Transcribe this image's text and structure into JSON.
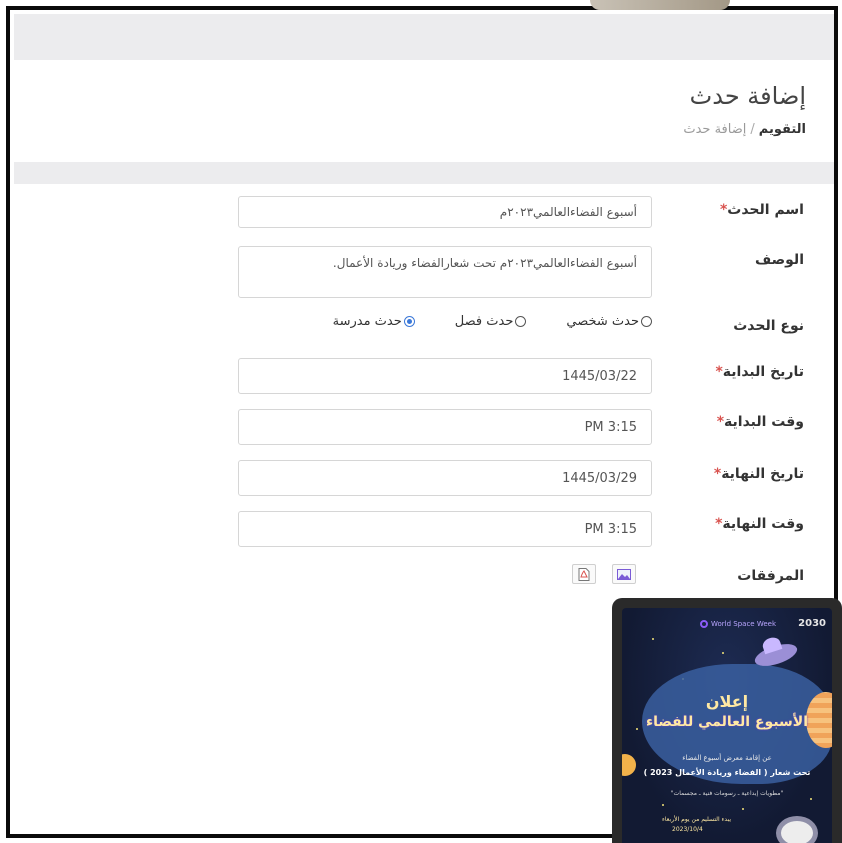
{
  "header": {
    "title": "إضافة حدث",
    "breadcrumb_home": "التقويم",
    "breadcrumb_sep": "/",
    "breadcrumb_current": "إضافة حدث"
  },
  "form": {
    "name_label": "اسم الحدث",
    "name_value": "أسبوع الفضاءالعالمي٢٠٢٣م",
    "desc_label": "الوصف",
    "desc_value": "أسبوع الفضاءالعالمي٢٠٢٣م تحت شعارالفضاء وريادة الأعمال.",
    "type_label": "نوع الحدث",
    "type_options": [
      "حدث شخصي",
      "حدث فصل",
      "حدث مدرسة"
    ],
    "type_selected": "حدث مدرسة",
    "start_date_label": "تاريخ البداية",
    "start_date_value": "1445/03/22",
    "start_time_label": "وقت البداية",
    "start_time_value": "3:15 PM",
    "end_date_label": "تاريخ النهاية",
    "end_date_value": "1445/03/29",
    "end_time_label": "وقت النهاية",
    "end_time_value": "3:15 PM",
    "attachments_label": "المرفقات",
    "required_mark": "*"
  },
  "poster": {
    "logo_text": "World Space Week",
    "vision": "2030",
    "title_line1": "إعلان",
    "title_line2": "الأسبوع العالمي للفضاء",
    "line1": "عن إقامة معرض أسبوع الفضاء",
    "line2": "تحت شعار ( الفضاء وريادة الأعمال 2023 )",
    "line3": "\"مطويات إبداعية ـ رسومات فنية ـ مجسمات\"",
    "line4": "يبدء التسليم من يوم الأربعاء",
    "line5": "2023/10/4"
  },
  "colors": {
    "accent": "#3b78d8",
    "required": "#d9534f",
    "band": "#ececee"
  }
}
